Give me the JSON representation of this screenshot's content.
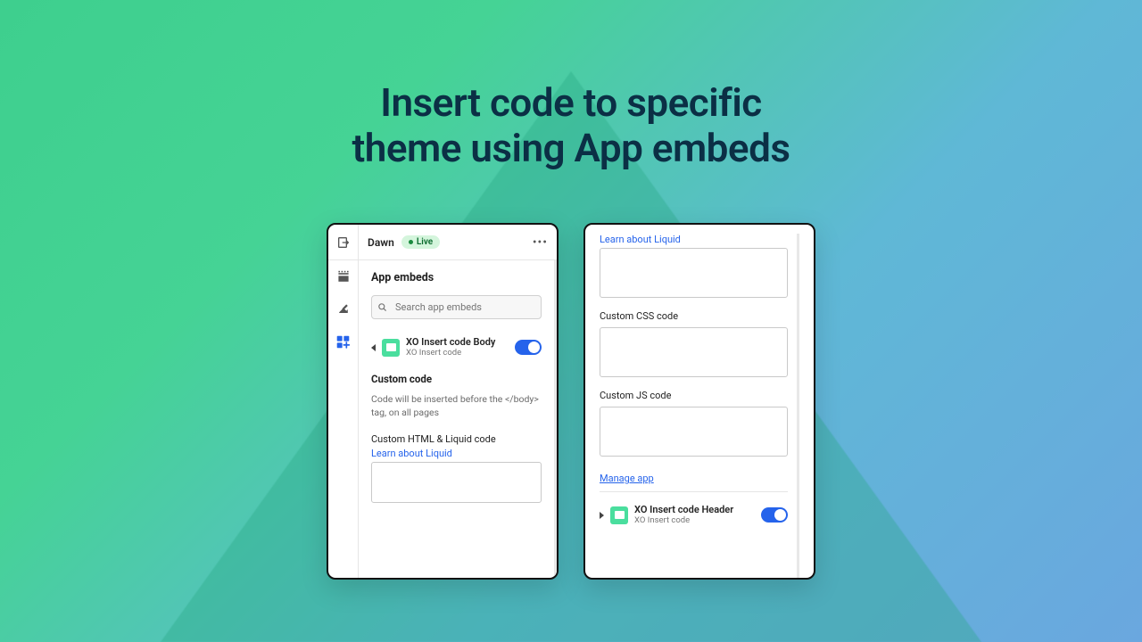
{
  "headline": "Insert code to specific\ntheme using App embeds",
  "card1": {
    "theme": "Dawn",
    "badge": "Live",
    "section": "App embeds",
    "searchPlaceholder": "Search app embeds",
    "embed": {
      "title": "XO Insert code Body",
      "sub": "XO Insert code"
    },
    "custom": {
      "heading": "Custom code",
      "desc": "Code will be inserted before the </body> tag, on all pages",
      "htmlLabel": "Custom HTML & Liquid code",
      "liquidLink": "Learn about Liquid"
    }
  },
  "card2": {
    "liquidLink": "Learn about Liquid",
    "cssLabel": "Custom CSS code",
    "jsLabel": "Custom JS code",
    "manage": "Manage app",
    "embed": {
      "title": "XO Insert code Header",
      "sub": "XO Insert code"
    }
  }
}
